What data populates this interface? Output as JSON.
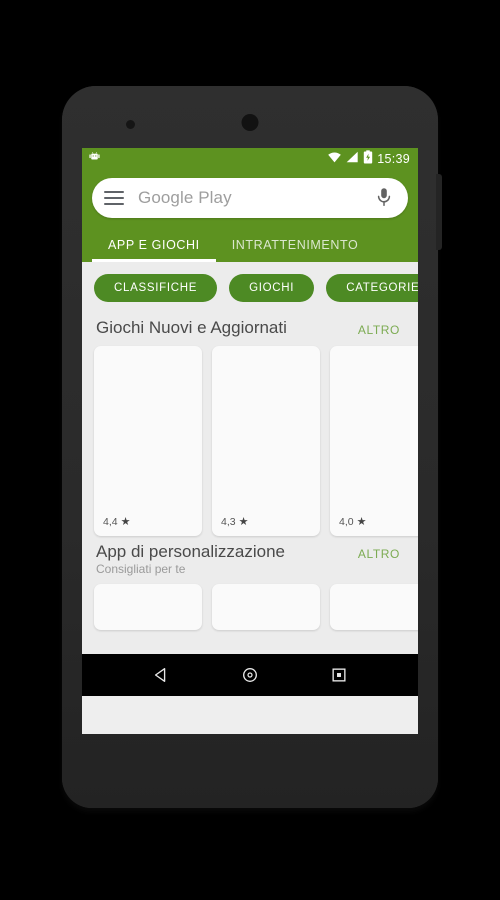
{
  "device": {
    "type": "android-phone-mockup"
  },
  "status_bar": {
    "time": "15:39",
    "icons": [
      "android-robot-icon",
      "wifi-icon",
      "signal-icon",
      "battery-charging-icon"
    ]
  },
  "app_bar": {
    "menu_icon": "hamburger-menu-icon",
    "search_placeholder": "Google Play",
    "mic_icon": "microphone-icon",
    "background_color": "#5d9220"
  },
  "tabs": [
    {
      "label": "APP E GIOCHI",
      "active": true
    },
    {
      "label": "INTRATTENIMENTO",
      "active": false
    }
  ],
  "chips": [
    {
      "label": "CLASSIFICHE"
    },
    {
      "label": "GIOCHI"
    },
    {
      "label": "CATEGORIE"
    }
  ],
  "sections": [
    {
      "title": "Giochi Nuovi e Aggiornati",
      "subtitle": "",
      "more_label": "ALTRO",
      "cards": [
        {
          "rating": "4,4",
          "star": "★"
        },
        {
          "rating": "4,3",
          "star": "★"
        },
        {
          "rating": "4,0",
          "star": "★"
        }
      ]
    },
    {
      "title": "App di personalizzazione",
      "subtitle": "Consigliati per te",
      "more_label": "ALTRO",
      "cards": [
        {
          "rating": "",
          "star": ""
        },
        {
          "rating": "",
          "star": ""
        },
        {
          "rating": "",
          "star": ""
        }
      ]
    }
  ],
  "nav_bar": {
    "back_label": "back-icon",
    "home_label": "home-icon",
    "recents_label": "recents-icon"
  },
  "colors": {
    "brand_green": "#5d9220",
    "chip_green": "#4d8a24",
    "more_link_green": "#7cab52",
    "content_bg": "#ececec",
    "card_bg": "#fafafa",
    "frame": "#2b2b2b",
    "page_bg": "#000000"
  }
}
